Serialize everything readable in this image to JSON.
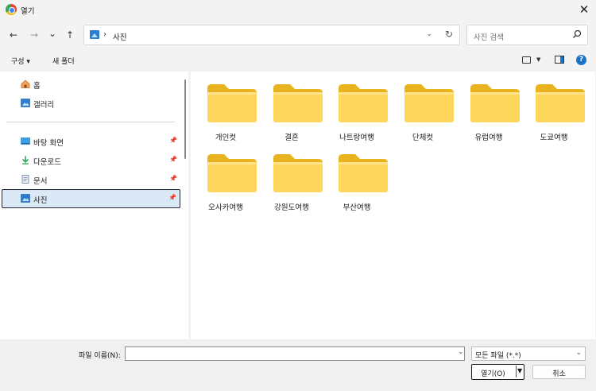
{
  "window": {
    "title": "열기"
  },
  "nav": {
    "back": "←",
    "forward": "→",
    "recent": "⌄",
    "up": "↑",
    "path_sep": "›",
    "path": "사진",
    "search_placeholder": "사진 검색"
  },
  "toolbar": {
    "organize_label": "구성 ▾",
    "new_folder_label": "새 폴더",
    "help": "?"
  },
  "sidebar": {
    "items": [
      {
        "label": "홈",
        "icon": "home-icon",
        "pinned": false
      },
      {
        "label": "갤러리",
        "icon": "gallery-icon",
        "pinned": false
      },
      {
        "label": "바탕 화면",
        "icon": "desktop-icon",
        "pinned": true
      },
      {
        "label": "다운로드",
        "icon": "download-icon",
        "pinned": true
      },
      {
        "label": "문서",
        "icon": "document-icon",
        "pinned": true
      },
      {
        "label": "사진",
        "icon": "pictures-icon",
        "pinned": true,
        "selected": true
      }
    ],
    "pin_glyph": "📌"
  },
  "folders": [
    {
      "label": "개인컷"
    },
    {
      "label": "결혼"
    },
    {
      "label": "나트랑여행"
    },
    {
      "label": "단체컷"
    },
    {
      "label": "유럽여행"
    },
    {
      "label": "도쿄여행"
    },
    {
      "label": "오사카여행"
    },
    {
      "label": "강원도여행"
    },
    {
      "label": "부산여행"
    }
  ],
  "footer": {
    "filename_label": "파일 이름(N):",
    "filename_value": "",
    "filetype_value": "모든 파일 (*.*)",
    "open_label": "열기(O)",
    "cancel_label": "취소"
  },
  "colors": {
    "folder_back": "#e9b320",
    "folder_front": "#ffd65c",
    "accent": "#1a73c9",
    "selection": "#dbe9f7"
  }
}
